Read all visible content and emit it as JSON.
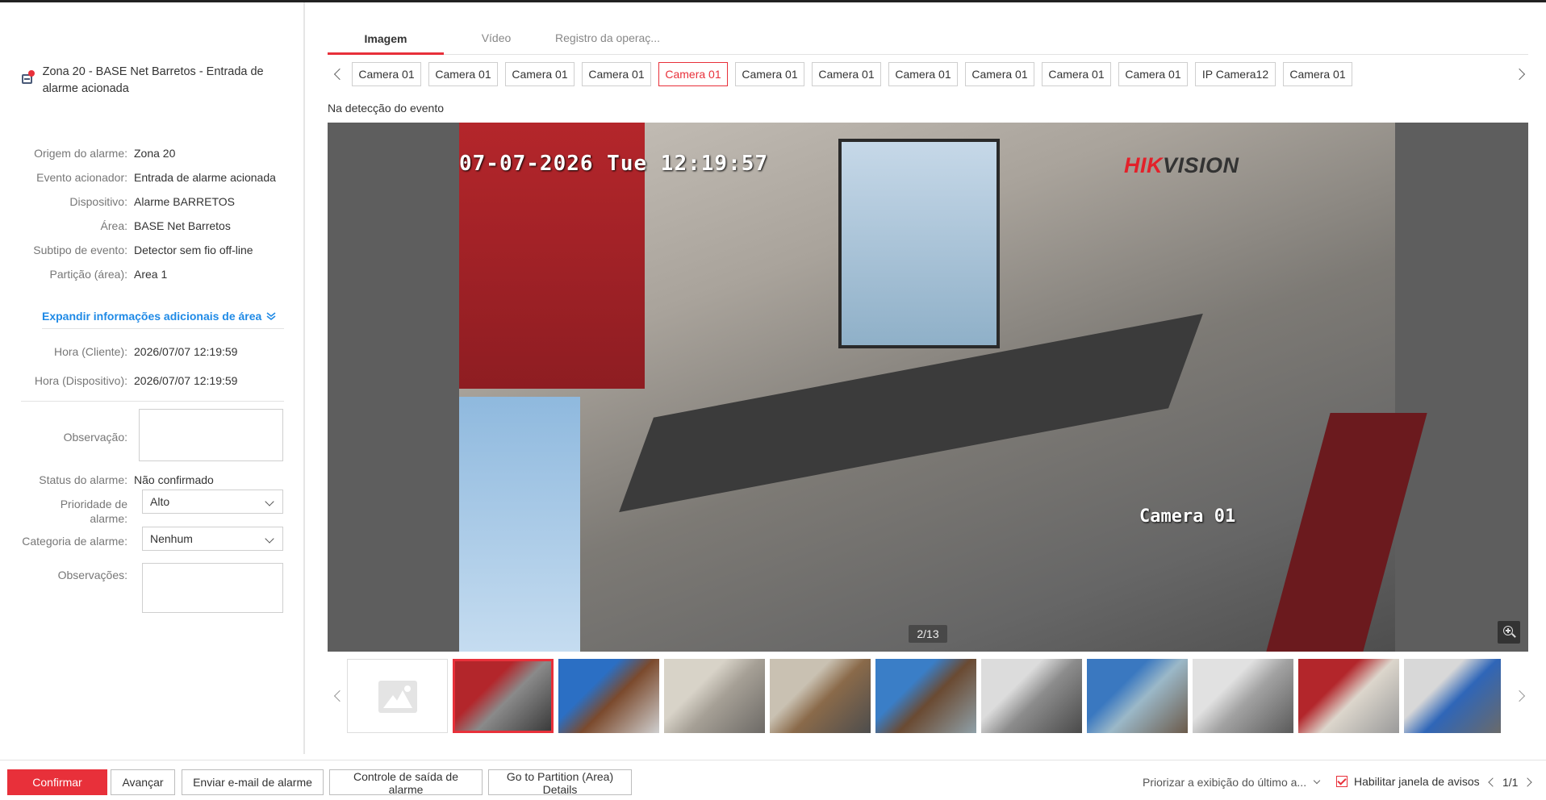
{
  "alarm": {
    "title": "Zona 20 - BASE Net Barretos - Entrada de alarme acionada"
  },
  "details": [
    {
      "label": "Origem do alarme:",
      "value": "Zona 20"
    },
    {
      "label": "Evento acionador:",
      "value": "Entrada de alarme acionada"
    },
    {
      "label": "Dispositivo:",
      "value": "Alarme BARRETOS"
    },
    {
      "label": "Área:",
      "value": "BASE Net Barretos"
    },
    {
      "label": "Subtipo de evento:",
      "value": "Detector sem fio off-line"
    },
    {
      "label": "Partição (área):",
      "value": "Area 1"
    }
  ],
  "expand_label": "Expandir informações adicionais de área",
  "times": [
    {
      "label": "Hora (Cliente):",
      "value": "2026/07/07 12:19:59"
    },
    {
      "label": "Hora (Dispositivo):",
      "value": "2026/07/07 12:19:59"
    }
  ],
  "form": {
    "observacao_label": "Observação:",
    "observacao_value": "",
    "status_label": "Status do alarme:",
    "status_value": "Não confirmado",
    "prioridade_label": "Prioridade de alarme:",
    "prioridade_value": "Alto",
    "categoria_label": "Categoria de alarme:",
    "categoria_value": "Nenhum",
    "observacoes_label": "Observações:",
    "observacoes_value": ""
  },
  "tabs": [
    {
      "label": "Imagem",
      "active": true
    },
    {
      "label": "Vídeo",
      "active": false
    },
    {
      "label": "Registro da operaç...",
      "active": false
    }
  ],
  "cameras": [
    "Camera 01",
    "Camera 01",
    "Camera 01",
    "Camera 01",
    "Camera 01",
    "Camera 01",
    "Camera 01",
    "Camera 01",
    "Camera 01",
    "Camera 01",
    "Camera 01",
    "IP Camera12",
    "Camera 01"
  ],
  "active_camera_index": 4,
  "detect_label": "Na detecção do evento",
  "video": {
    "timestamp": "07-07-2026 Tue 12:19:57",
    "brand_hik": "HIK",
    "brand_vision": "VISION",
    "osd_name": "Camera 01",
    "counter": "2/13"
  },
  "thumbnails": {
    "active_index": 1,
    "count": 11
  },
  "footer": {
    "confirm": "Confirmar",
    "advance": "Avançar",
    "email": "Enviar e-mail de alarme",
    "output": "Controle de saída de alarme",
    "partition": "Go to Partition (Area) Details",
    "priority_view": "Priorizar a exibição do último a...",
    "enable_window": "Habilitar janela de avisos",
    "pager": "1/1"
  },
  "colors": {
    "accent": "#e8303a",
    "link": "#1f8ae6"
  }
}
